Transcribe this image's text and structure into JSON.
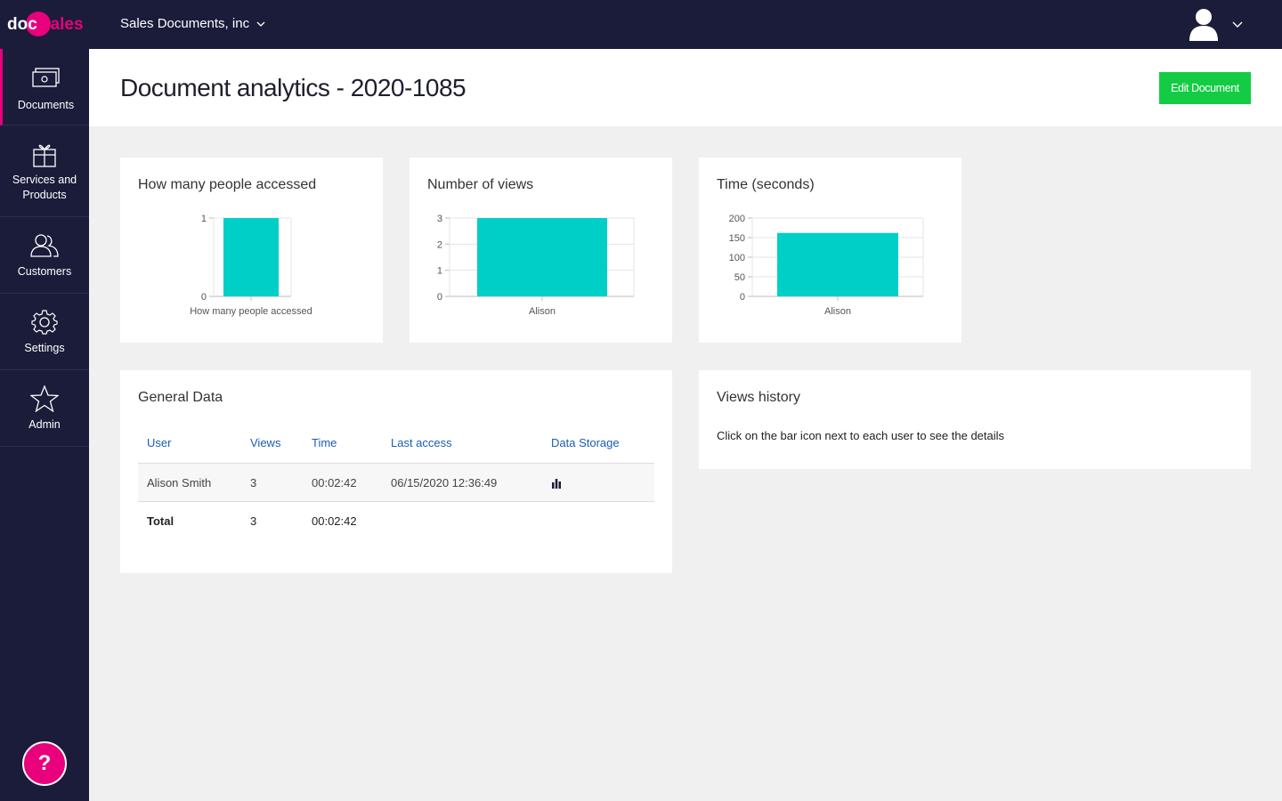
{
  "brand": {
    "logo_text_a": "doc",
    "logo_text_b": "sales",
    "accent": "#e8007d",
    "nav_bg": "#1b1c3a"
  },
  "topbar": {
    "company": "Sales Documents, inc",
    "user_icon": "user-icon"
  },
  "sidebar": {
    "items": [
      {
        "label": "Documents",
        "icon": "documents-icon"
      },
      {
        "label": "Services and Products",
        "icon": "gift-icon"
      },
      {
        "label": "Customers",
        "icon": "customers-icon"
      },
      {
        "label": "Settings",
        "icon": "gear-icon"
      },
      {
        "label": "Admin",
        "icon": "star-icon"
      }
    ],
    "help": "?"
  },
  "header": {
    "title": "Document analytics - 2020-1085",
    "edit_label": "Edit Document"
  },
  "chart_data": [
    {
      "type": "bar",
      "title": "How many people accessed",
      "categories": [
        "How many people accessed"
      ],
      "values": [
        1
      ],
      "ylim": [
        0,
        1
      ],
      "yticks": [
        0,
        1
      ],
      "color": "#00cfc8"
    },
    {
      "type": "bar",
      "title": "Number of views",
      "categories": [
        "Alison"
      ],
      "values": [
        3
      ],
      "ylim": [
        0,
        3
      ],
      "yticks": [
        0,
        1,
        2,
        3
      ],
      "color": "#00cfc8"
    },
    {
      "type": "bar",
      "title": "Time (seconds)",
      "categories": [
        "Alison"
      ],
      "values": [
        162
      ],
      "ylim": [
        0,
        200
      ],
      "yticks": [
        0,
        50,
        100,
        150,
        200
      ],
      "color": "#00cfc8"
    }
  ],
  "general": {
    "title": "General Data",
    "columns": [
      "User",
      "Views",
      "Time",
      "Last access",
      "Data Storage"
    ],
    "rows": [
      {
        "user": "Alison Smith",
        "views": "3",
        "time": "00:02:42",
        "last_access": "06/15/2020 12:36:49",
        "storage_icon": "bar-chart-icon"
      }
    ],
    "total": {
      "label": "Total",
      "views": "3",
      "time": "00:02:42"
    }
  },
  "views_history": {
    "title": "Views history",
    "description": "Click on the bar icon next to each user to see the details"
  }
}
